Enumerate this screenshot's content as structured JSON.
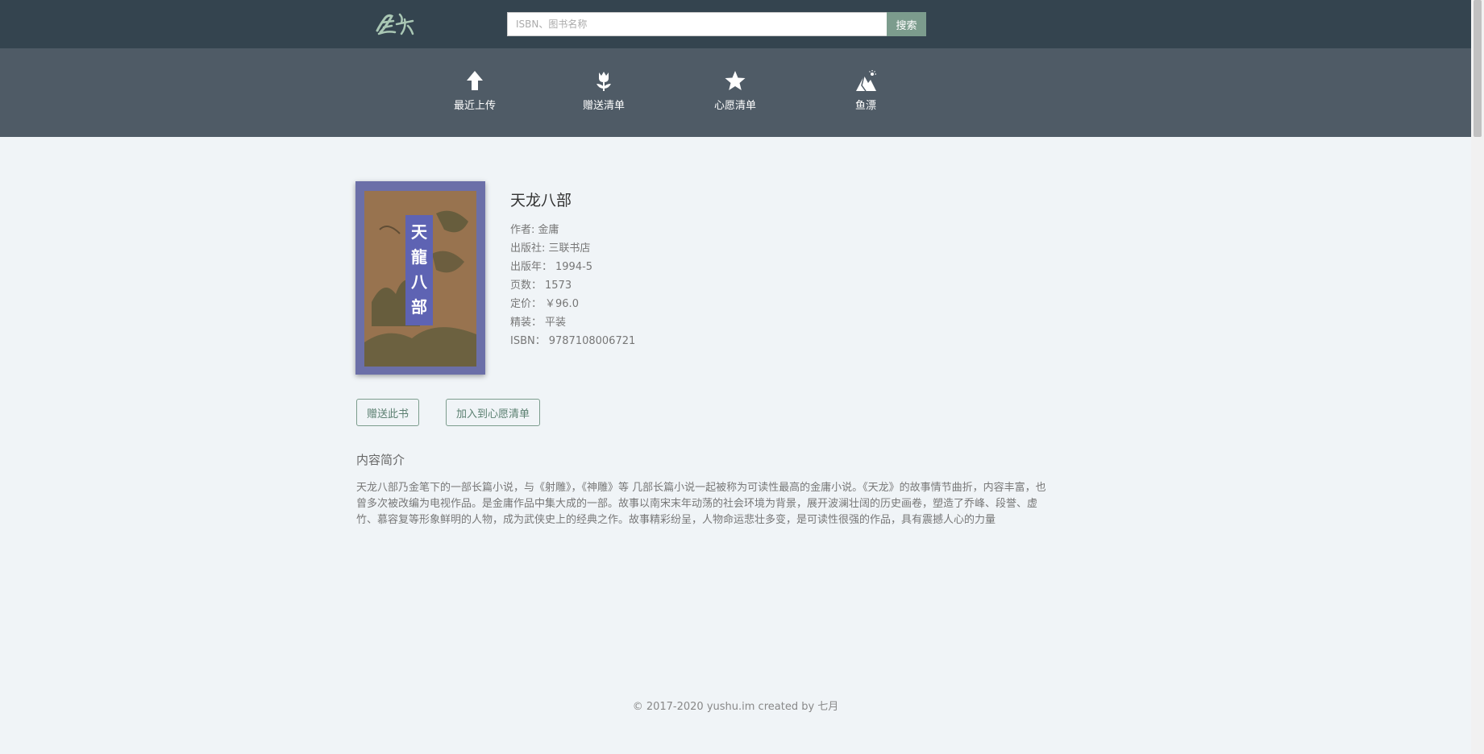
{
  "header": {
    "logo_alt": "鱼书",
    "search_placeholder": "ISBN、图书名称",
    "search_button": "搜索"
  },
  "nav": [
    {
      "label": "最近上传",
      "icon": "upload-arrow-icon"
    },
    {
      "label": "赠送清单",
      "icon": "tulip-icon"
    },
    {
      "label": "心愿清单",
      "icon": "star-icon"
    },
    {
      "label": "鱼漂",
      "icon": "mountain-icon"
    }
  ],
  "book": {
    "title": "天龙八部",
    "author_label": "作者:",
    "author": "金庸",
    "publisher_label": "出版社:",
    "publisher": "三联书店",
    "pubdate_label": "出版年：",
    "pubdate": "1994-5",
    "pages_label": "页数：",
    "pages": "1573",
    "price_label": "定价：",
    "price": "￥96.0",
    "binding_label": "精装：",
    "binding": "平装",
    "isbn_label": "ISBN：",
    "isbn": "9787108006721",
    "cover_text": "天龍八部"
  },
  "actions": {
    "gift": "赠送此书",
    "wish": "加入到心愿清单"
  },
  "summary": {
    "title": "内容简介",
    "text": "天龙八部乃金笔下的一部长篇小说，与《射雕》，《神雕》等 几部长篇小说一起被称为可读性最高的金庸小说。《天龙》的故事情节曲折，内容丰富，也曾多次被改编为电视作品。是金庸作品中集大成的一部。故事以南宋末年动荡的社会环境为背景，展开波澜壮阔的历史画卷，塑造了乔峰、段誉、虚竹、慕容复等形象鲜明的人物，成为武侠史上的经典之作。故事精彩纷呈，人物命运悲壮多变，是可读性很强的作品，具有震撼人心的力量"
  },
  "footer": "© 2017-2020 yushu.im created by 七月",
  "colors": {
    "header_bg": "#34444f",
    "nav_bg": "#4f5b66",
    "accent": "#7c9c8d",
    "page_bg": "#f0f4f7"
  }
}
